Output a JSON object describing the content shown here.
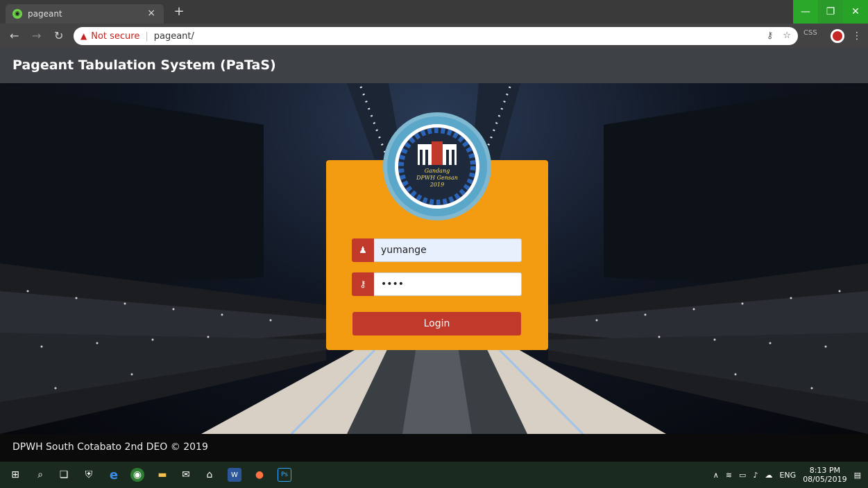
{
  "browser": {
    "tab_title": "pageant",
    "tab_close": "×",
    "new_tab": "+",
    "not_secure": "Not secure",
    "url": "pageant/",
    "extension_label": "CSS",
    "window_minimize": "—",
    "window_restore": "❐",
    "window_close": "✕"
  },
  "header": {
    "title": "Pageant Tabulation System (PaTaS)"
  },
  "logo": {
    "line1": "Gandang",
    "line2": "DPWH Gensan",
    "line3": "2019"
  },
  "login": {
    "username_value": "yumange",
    "password_value": "1234",
    "button_label": "Login"
  },
  "footer": {
    "text": "DPWH South Cotabato 2nd DEO © 2019"
  },
  "taskbar": {
    "language": "ENG",
    "time": "8:13 PM",
    "date": "08/05/2019"
  },
  "colors": {
    "card": "#f39c12",
    "accent": "#c0392b",
    "header": "#3e4246"
  }
}
